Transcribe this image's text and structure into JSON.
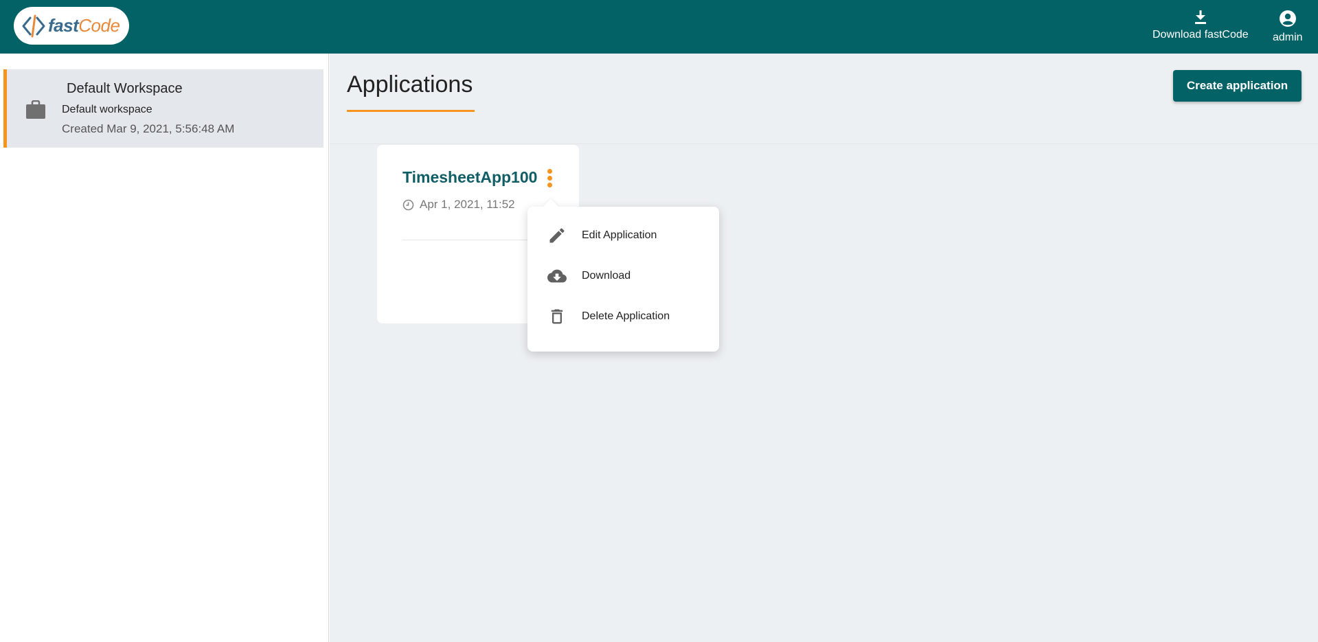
{
  "header": {
    "logo": {
      "part1": "fast",
      "part2": "Code"
    },
    "download_label": "Download fastCode",
    "admin_label": "admin"
  },
  "sidebar": {
    "workspace": {
      "title": "Default Workspace",
      "subtitle": "Default workspace",
      "created": "Created Mar 9, 2021, 5:56:48 AM"
    }
  },
  "main": {
    "title": "Applications",
    "create_label": "Create application",
    "apps": [
      {
        "name": "TimesheetApp100",
        "date": "Apr 1, 2021, 11:52"
      }
    ]
  },
  "menu": {
    "items": [
      {
        "label": "Edit Application",
        "icon": "pencil-icon"
      },
      {
        "label": "Download",
        "icon": "cloud-download-icon"
      },
      {
        "label": "Delete Application",
        "icon": "trash-icon"
      }
    ]
  },
  "colors": {
    "primary": "#026266",
    "accent": "#f7941d",
    "background": "#edf0f2"
  }
}
